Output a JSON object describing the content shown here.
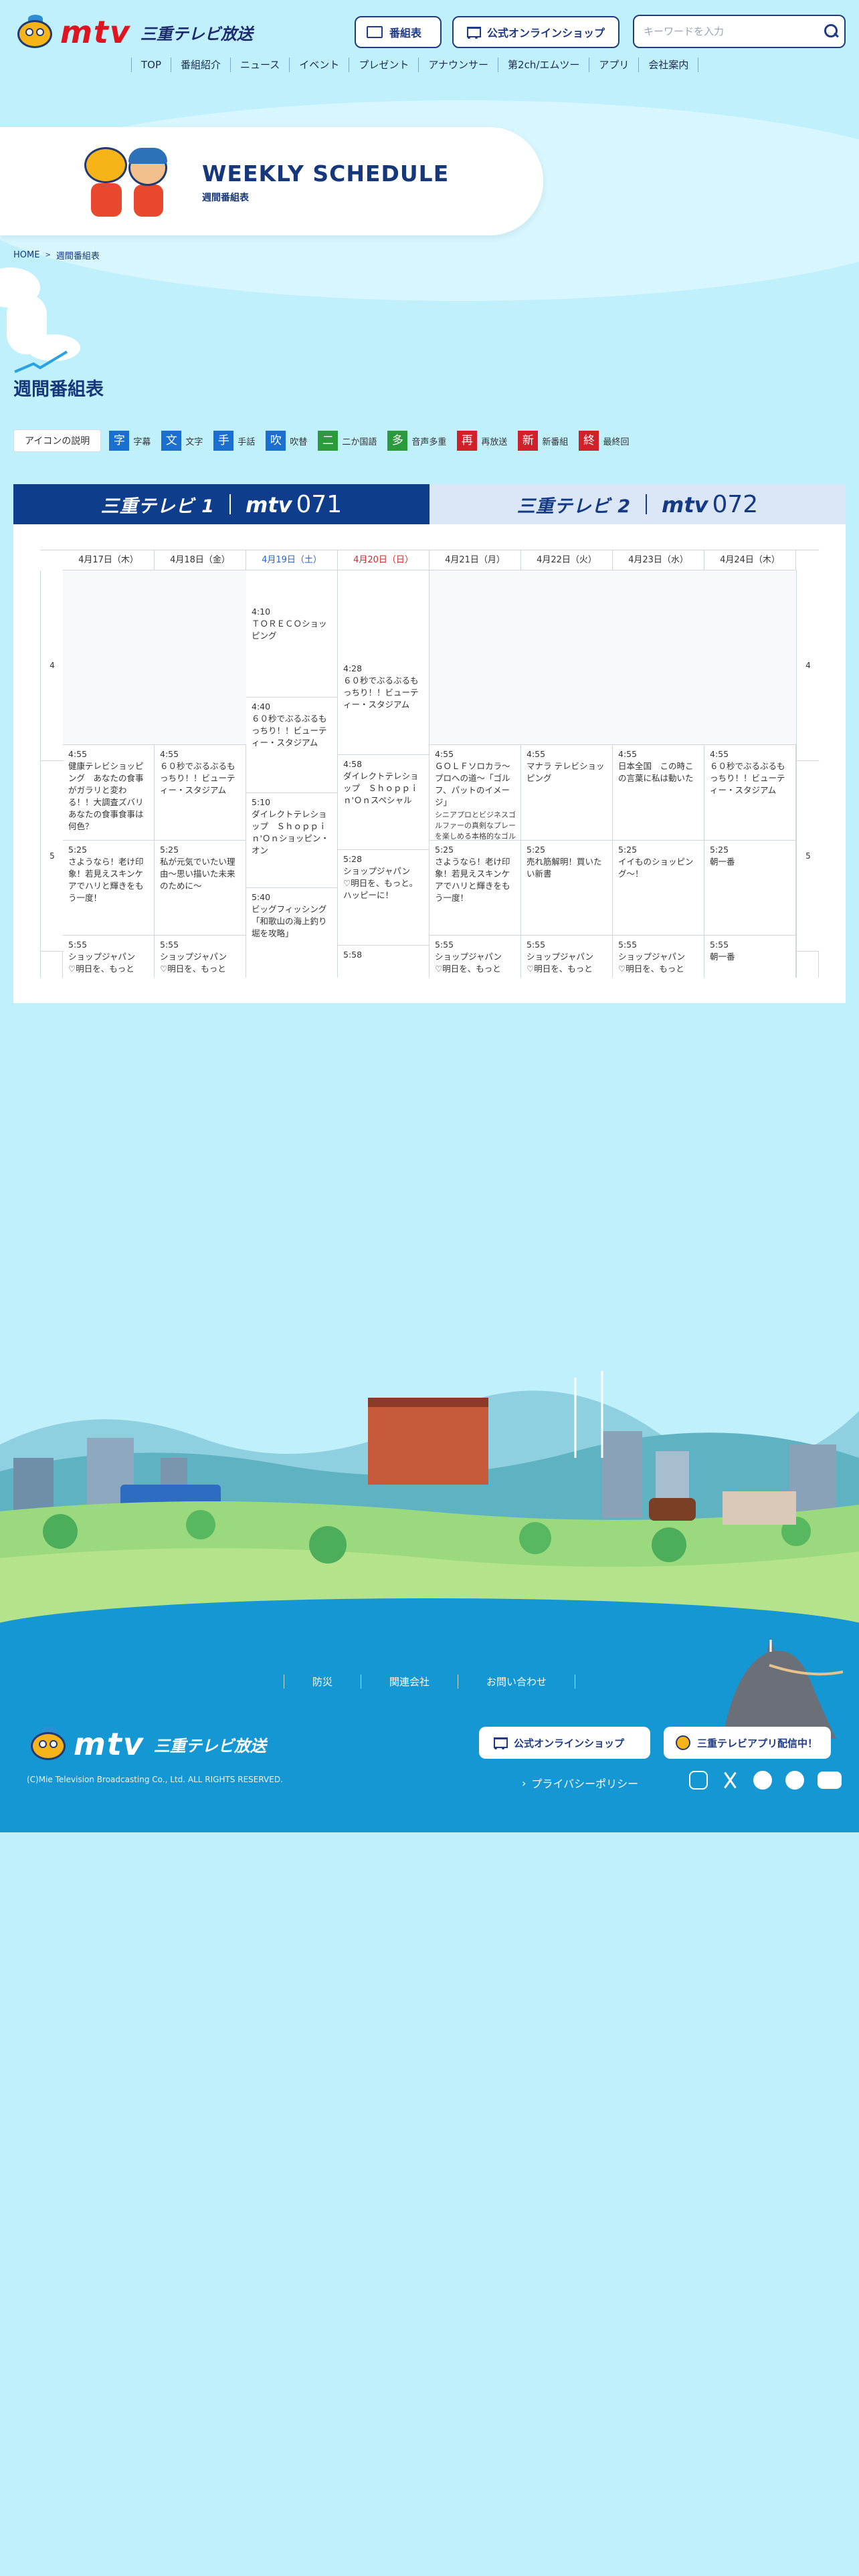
{
  "header": {
    "logo_text": "mtv",
    "brand_text": "三重テレビ放送",
    "buttons": [
      {
        "label": "番組表",
        "icon": "tv-icon"
      },
      {
        "label": "公式オンラインショップ",
        "icon": "cart-icon"
      }
    ],
    "search": {
      "placeholder": "キーワードを入力",
      "value": ""
    },
    "nav": [
      "TOP",
      "番組紹介",
      "ニュース",
      "イベント",
      "プレゼント",
      "アナウンサー",
      "第2ch/エムツー",
      "アプリ",
      "会社案内"
    ]
  },
  "hero": {
    "title": "WEEKLY SCHEDULE",
    "subtitle": "週間番組表"
  },
  "breadcrumb": [
    "HOME",
    "週間番組表"
  ],
  "page_title": "週間番組表",
  "legend": {
    "button": "アイコンの説明",
    "items": [
      {
        "glyph": "字",
        "label": "字幕",
        "color": "#1a6fcf"
      },
      {
        "glyph": "文",
        "label": "文字",
        "color": "#1a6fcf"
      },
      {
        "glyph": "手",
        "label": "手話",
        "color": "#1a6fcf"
      },
      {
        "glyph": "吹",
        "label": "吹替",
        "color": "#1a6fcf"
      },
      {
        "glyph": "二",
        "label": "二か国語",
        "color": "#2a9a3a"
      },
      {
        "glyph": "多",
        "label": "音声多重",
        "color": "#2a9a3a"
      },
      {
        "glyph": "再",
        "label": "再放送",
        "color": "#d0202a"
      },
      {
        "glyph": "新",
        "label": "新番組",
        "color": "#d0202a"
      },
      {
        "glyph": "終",
        "label": "最終回",
        "color": "#d0202a"
      }
    ]
  },
  "channels": [
    {
      "name": "三重テレビ 1",
      "brand": "mtv",
      "number": "071",
      "active": true
    },
    {
      "name": "三重テレビ 2",
      "brand": "mtv",
      "number": "072",
      "active": false
    }
  ],
  "hours": [
    "4",
    "5"
  ],
  "days": [
    {
      "label": "4月17日（木）",
      "kind": "normal",
      "programs": [
        {
          "time": "",
          "title": "",
          "desc": "",
          "empty": true
        },
        {
          "time": "4:55",
          "title": "健康テレビショッピング　あなたの食事がガラリと変わる！！大調査ズバリあなたの食事食事は何色？",
          "desc": ""
        },
        {
          "time": "5:25",
          "title": "さようなら！老け印象！若見えスキンケアでハリと輝きをもう一度！",
          "desc": ""
        },
        {
          "time": "5:55",
          "title": "ショップジャパン　♡明日を、もっと",
          "desc": ""
        }
      ]
    },
    {
      "label": "4月18日（金）",
      "kind": "normal",
      "programs": [
        {
          "time": "",
          "title": "",
          "desc": "",
          "empty": true
        },
        {
          "time": "4:55",
          "title": "６０秒でぶるぶるもっちり！！ビューティー・スタジアム",
          "desc": ""
        },
        {
          "time": "5:25",
          "title": "私が元気でいたい理由〜思い描いた未来のために〜",
          "desc": ""
        },
        {
          "time": "5:55",
          "title": "ショップジャパン　♡明日を、もっと",
          "desc": ""
        }
      ]
    },
    {
      "label": "4月19日（土）",
      "kind": "sat",
      "programs": [
        {
          "time": "4:10",
          "title": "ＴＯＲＥＣＯショッピング",
          "desc": ""
        },
        {
          "time": "4:40",
          "title": "６０秒でぶるぶるもっちり！！ビューティー・スタジアム",
          "desc": ""
        },
        {
          "time": "5:10",
          "title": "ダイレクトテレショップ　Ｓｈｏｐｐｉｎ'Ｏｎショッピン・オン",
          "desc": ""
        },
        {
          "time": "5:40",
          "title": "ビッグフィッシング　「和歌山の海上釣り堀を攻略」",
          "desc": ""
        }
      ]
    },
    {
      "label": "4月20日（日）",
      "kind": "sun",
      "programs": [
        {
          "time": "4:28",
          "title": "６０秒でぶるぶるもっちり！！ビューティー・スタジアム",
          "desc": ""
        },
        {
          "time": "4:58",
          "title": "ダイレクトテレショップ　Ｓｈｏｐｐｉｎ'Ｏｎスペシャル",
          "desc": ""
        },
        {
          "time": "5:28",
          "title": "ショップジャパン　♡明日を、もっと。ハッピーに！",
          "desc": ""
        },
        {
          "time": "5:58",
          "title": "",
          "desc": ""
        }
      ]
    },
    {
      "label": "4月21日（月）",
      "kind": "normal",
      "programs": [
        {
          "time": "",
          "title": "",
          "desc": "",
          "empty": true
        },
        {
          "time": "4:55",
          "title": "ＧＯＬＦソロカラ〜プロへの道〜「ゴルフ、パットのイメージ」",
          "desc": "シニアプロとビジネスゴルファーの真剣なプレーを楽しめる本格的なゴルフ番組として、皆様にお届けいたします。"
        },
        {
          "time": "5:25",
          "title": "さようなら！老け印象！若見えスキンケアでハリと輝きをもう一度！",
          "desc": ""
        },
        {
          "time": "5:55",
          "title": "ショップジャパン　♡明日を、もっと",
          "desc": ""
        }
      ]
    },
    {
      "label": "4月22日（火）",
      "kind": "normal",
      "programs": [
        {
          "time": "",
          "title": "",
          "desc": "",
          "empty": true
        },
        {
          "time": "4:55",
          "title": "マナラ テレビショッピング",
          "desc": ""
        },
        {
          "time": "5:25",
          "title": "売れ筋解明！買いたい新書",
          "desc": ""
        },
        {
          "time": "5:55",
          "title": "ショップジャパン　♡明日を、もっと",
          "desc": ""
        }
      ]
    },
    {
      "label": "4月23日（水）",
      "kind": "normal",
      "programs": [
        {
          "time": "",
          "title": "",
          "desc": "",
          "empty": true
        },
        {
          "time": "4:55",
          "title": "日本全国　この時この言葉に私は動いた",
          "desc": ""
        },
        {
          "time": "5:25",
          "title": "イイものショッピング〜！",
          "desc": ""
        },
        {
          "time": "5:55",
          "title": "ショップジャパン　♡明日を、もっと",
          "desc": ""
        }
      ]
    },
    {
      "label": "4月24日（木）",
      "kind": "normal",
      "programs": [
        {
          "time": "",
          "title": "",
          "desc": "",
          "empty": true
        },
        {
          "time": "4:55",
          "title": "６０秒でぶるぶるもっちり！！ビューティー・スタジアム",
          "desc": ""
        },
        {
          "time": "5:25",
          "title": "朝一番",
          "desc": ""
        },
        {
          "time": "5:55",
          "title": "朝一番",
          "desc": ""
        }
      ]
    }
  ],
  "footer": {
    "nav": [
      "防災",
      "関連会社",
      "お問い合わせ"
    ],
    "logo_text": "mtv",
    "brand_text": "三重テレビ放送",
    "copyright": "(C)Mie Television Broadcasting Co., Ltd. ALL RIGHTS RESERVED.",
    "shop_button": "公式オンラインショップ",
    "app_button": "三重テレビアプリ配信中！",
    "privacy": "プライバシーポリシー",
    "sns": [
      "instagram-icon",
      "x-icon",
      "facebook-icon",
      "tiktok-icon",
      "youtube-icon"
    ]
  }
}
